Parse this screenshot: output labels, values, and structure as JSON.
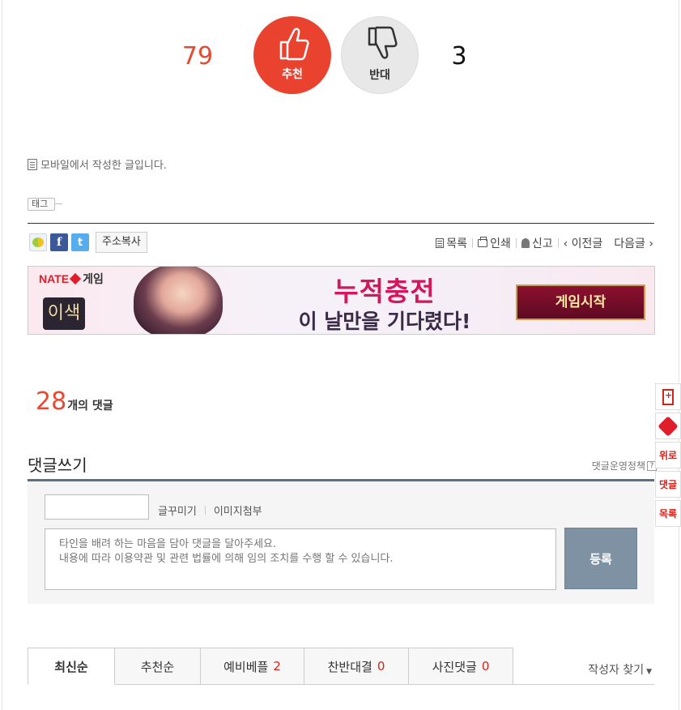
{
  "vote": {
    "up_count": "79",
    "up_label": "추천",
    "down_count": "3",
    "down_label": "반대"
  },
  "post": {
    "mobile_note": "모바일에서 작성한 글입니다.",
    "tag_label": "태그"
  },
  "share": {
    "facebook_glyph": "f",
    "twitter_glyph": "t",
    "copy_address": "주소복사"
  },
  "nav": {
    "list": "목록",
    "print": "인쇄",
    "report": "신고",
    "prev": "‹ 이전글",
    "next": "다음글 ›"
  },
  "banner": {
    "brand": "NATE",
    "brand_suffix": "게임",
    "logo": "이색",
    "headline": "누적충전",
    "sub": "이 날만을 기다렸다!",
    "start": "게임시작"
  },
  "comments": {
    "count": "28",
    "count_suffix": "개의 댓글",
    "write_title": "댓글쓰기",
    "policy": "댓글운영정책",
    "policy_q": "?",
    "decorate": "글꾸미기",
    "image_attach": "이미지첨부",
    "placeholder": "타인을 배려 하는 마음을 담아 댓글을 달아주세요.\n내용에 따라 이용약관 및 관련 법률에 의해 임의 조치를 수행 할 수 있습니다.",
    "submit": "등록"
  },
  "tabs": [
    {
      "label": "최신순",
      "count": ""
    },
    {
      "label": "추천순",
      "count": ""
    },
    {
      "label": "예비베플",
      "count": "2"
    },
    {
      "label": "찬반대결",
      "count": "0"
    },
    {
      "label": "사진댓글",
      "count": "0"
    }
  ],
  "author_find": "작성자 찾기",
  "float_bar": {
    "top": "위로",
    "comment": "댓글",
    "list": "목록"
  },
  "colors": {
    "accent_red": "#e64a33",
    "submit_gray_blue": "#7e92a4"
  }
}
